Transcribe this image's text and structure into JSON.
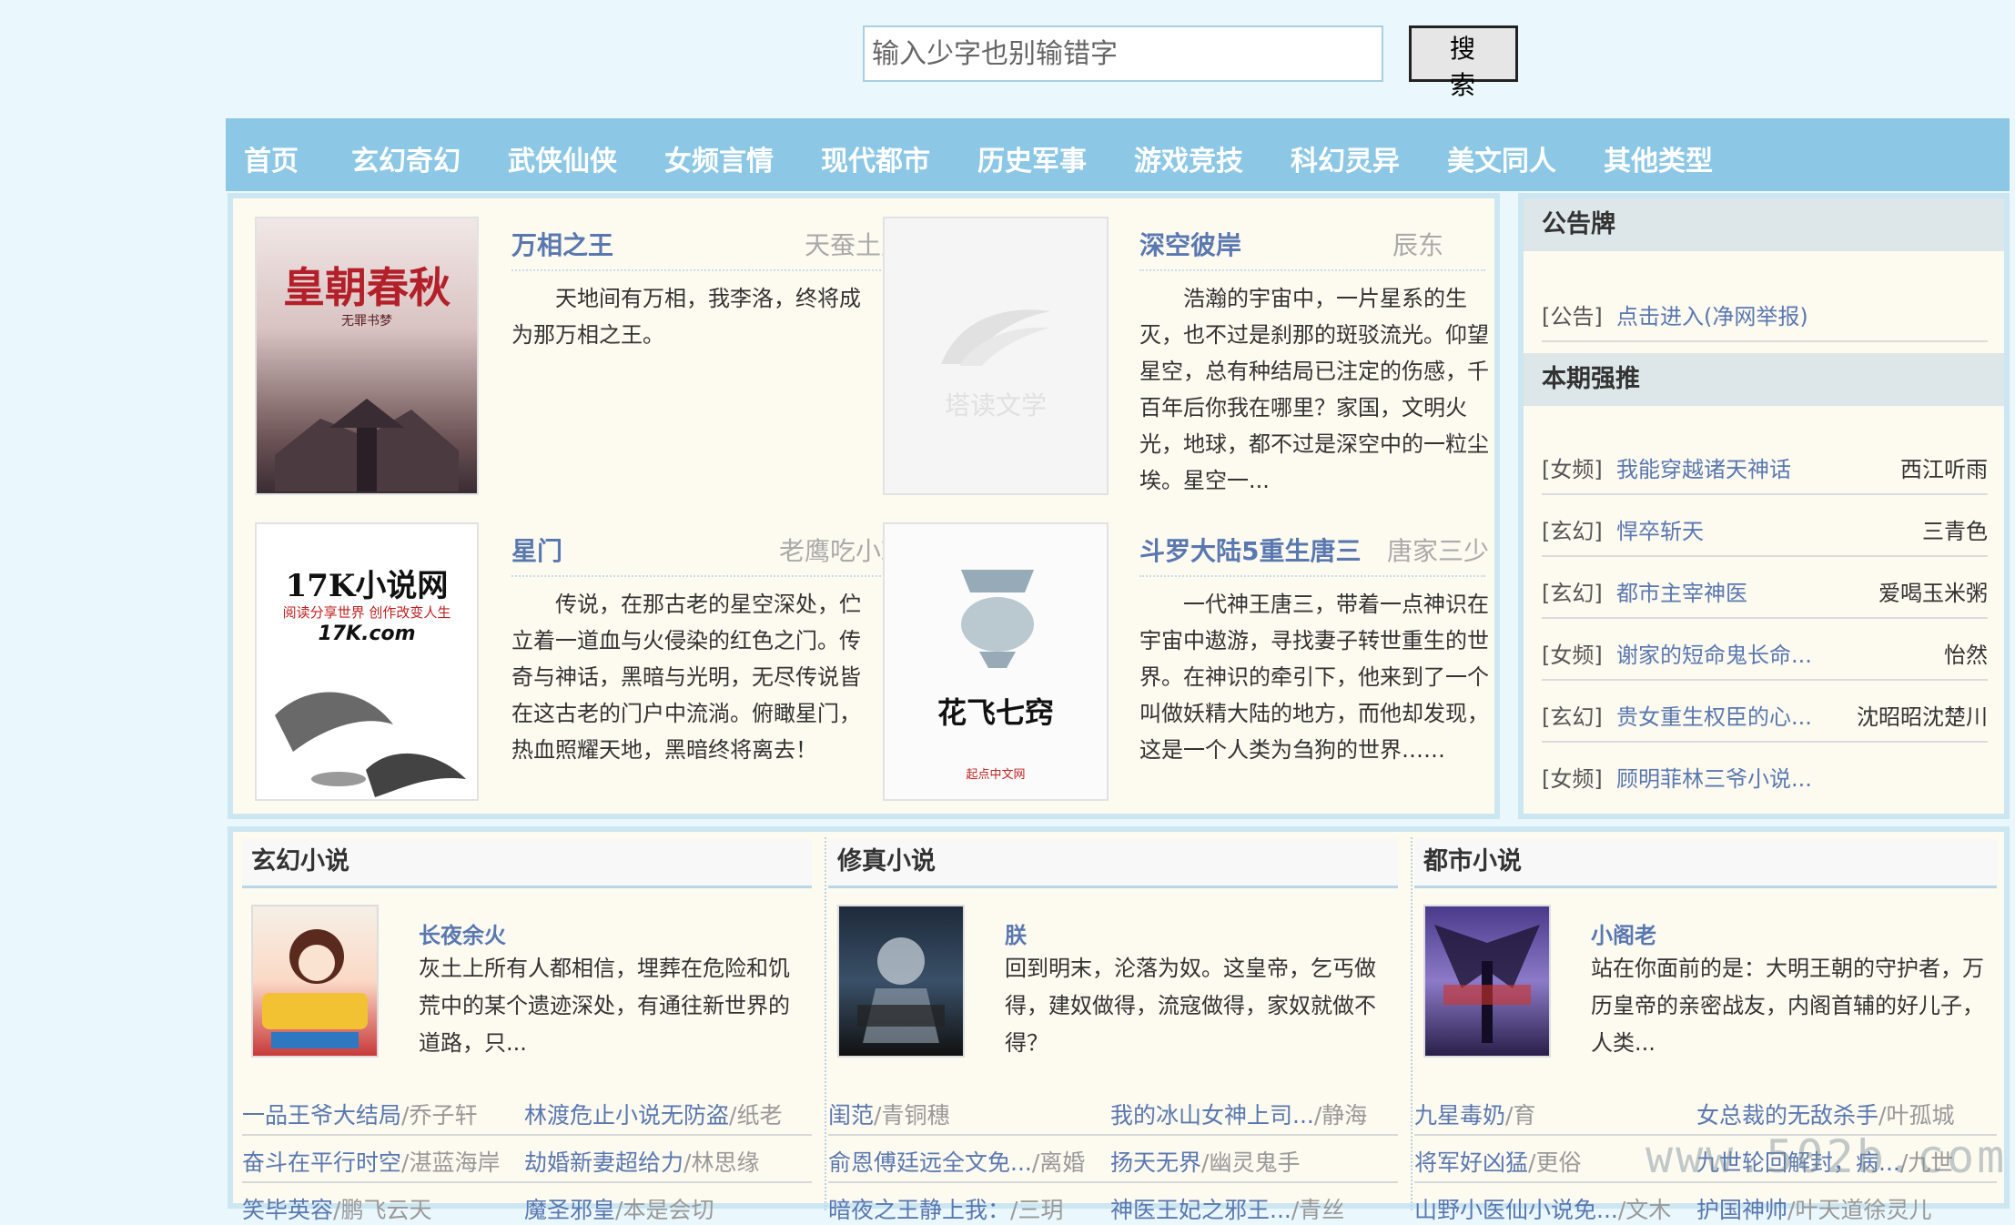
{
  "search": {
    "placeholder": "输入少字也别输错字",
    "button_label": "搜 索"
  },
  "nav": [
    "首页",
    "玄幻奇幻",
    "武侠仙侠",
    "女频言情",
    "现代都市",
    "历史军事",
    "游戏竞技",
    "科幻灵异",
    "美文同人",
    "其他类型"
  ],
  "featured": [
    {
      "title": "万相之王",
      "author": "天蚕土豆",
      "desc": "天地间有万相，我李洛，终将成为那万相之王。",
      "cover_text": "皇朝春秋",
      "cover_sub": "无罪书梦"
    },
    {
      "title": "深空彼岸",
      "author": "辰东",
      "desc": "浩瀚的宇宙中，一片星系的生灭，也不过是刹那的斑驳流光。仰望星空，总有种结局已注定的伤感，千百年后你我在哪里？家国，文明火光，地球，都不过是深空中的一粒尘埃。星空一...",
      "cover_text": "塔读文学"
    },
    {
      "title": "星门",
      "author": "老鹰吃小鸡",
      "desc": "传说，在那古老的星空深处，伫立着一道血与火侵染的红色之门。传奇与神话，黑暗与光明，无尽传说皆在这古老的门户中流淌。俯瞰星门，热血照耀天地，黑暗终将离去！",
      "cover_text": "17K小说网",
      "cover_sub": "阅读分享世界 创作改变人生",
      "cover_logo": "17K.com"
    },
    {
      "title": "斗罗大陆5重生唐三",
      "author": "唐家三少",
      "desc": "一代神王唐三，带着一点神识在宇宙中遨游，寻找妻子转世重生的世界。在神识的牵引下，他来到了一个叫做妖精大陆的地方，而他却发现，这是一个人类为刍狗的世界……",
      "cover_text": "花飞七窍",
      "cover_sub": "起点中文网"
    }
  ],
  "sidebar": {
    "notice_heading": "公告牌",
    "notice": {
      "tag": "[公告]",
      "text": "点击进入(净网举报)"
    },
    "recommend_heading": "本期强推",
    "items": [
      {
        "cat": "[女频]",
        "title": "我能穿越诸天神话",
        "author": "西江听雨"
      },
      {
        "cat": "[玄幻]",
        "title": "悍卒斩天",
        "author": "三青色"
      },
      {
        "cat": "[玄幻]",
        "title": "都市主宰神医",
        "author": "爱喝玉米粥"
      },
      {
        "cat": "[女频]",
        "title": "谢家的短命鬼长命...",
        "author": "怡然"
      },
      {
        "cat": "[玄幻]",
        "title": "贵女重生权臣的心...",
        "author": "沈昭昭沈楚川"
      },
      {
        "cat": "[女频]",
        "title": "顾明菲林三爷小说...",
        "author": ""
      }
    ]
  },
  "columns": [
    {
      "heading": "玄幻小说",
      "book": {
        "title": "长夜余火",
        "desc": "灰土上所有人都相信，埋葬在危险和饥荒中的某个遗迹深处，有通往新世界的道路，只..."
      },
      "links": [
        [
          {
            "title": "一品王爷大结局",
            "author": "乔子轩"
          },
          {
            "title": "林渡危止小说无防盗",
            "author": "纸老"
          }
        ],
        [
          {
            "title": "奋斗在平行时空",
            "author": "湛蓝海岸"
          },
          {
            "title": "劫婚新妻超给力",
            "author": "林思缘"
          }
        ],
        [
          {
            "title": "笑毕英容",
            "author": "鹏飞云天"
          },
          {
            "title": "魔圣邪皇",
            "author": "本是会切"
          }
        ]
      ]
    },
    {
      "heading": "修真小说",
      "book": {
        "title": "朕",
        "desc": "回到明末，沦落为奴。这皇帝，乞丐做得，建奴做得，流寇做得，家奴就做不得？"
      },
      "links": [
        [
          {
            "title": "闺范",
            "author": "青铜穗"
          },
          {
            "title": "我的冰山女神上司...",
            "author": "静海"
          }
        ],
        [
          {
            "title": "俞恩傅廷远全文免...",
            "author": "离婚"
          },
          {
            "title": "扬天无界",
            "author": "幽灵鬼手"
          }
        ],
        [
          {
            "title": "暗夜之王静上我：",
            "author": "三玥"
          },
          {
            "title": "神医王妃之邪王...",
            "author": "青丝"
          }
        ]
      ]
    },
    {
      "heading": "都市小说",
      "book": {
        "title": "小阁老",
        "desc": "站在你面前的是：大明王朝的守护者，万历皇帝的亲密战友，内阁首辅的好儿子，人类..."
      },
      "links": [
        [
          {
            "title": "九星毒奶",
            "author": "育"
          },
          {
            "title": "女总裁的无敌杀手",
            "author": "叶孤城"
          }
        ],
        [
          {
            "title": "将军好凶猛",
            "author": "更俗"
          },
          {
            "title": "九世轮回解封，病...",
            "author": "九世"
          }
        ],
        [
          {
            "title": "山野小医仙小说免...",
            "author": "文木"
          },
          {
            "title": "护国神帅",
            "author": "叶天道徐灵儿"
          }
        ]
      ]
    }
  ],
  "watermark": "www.502b.com"
}
